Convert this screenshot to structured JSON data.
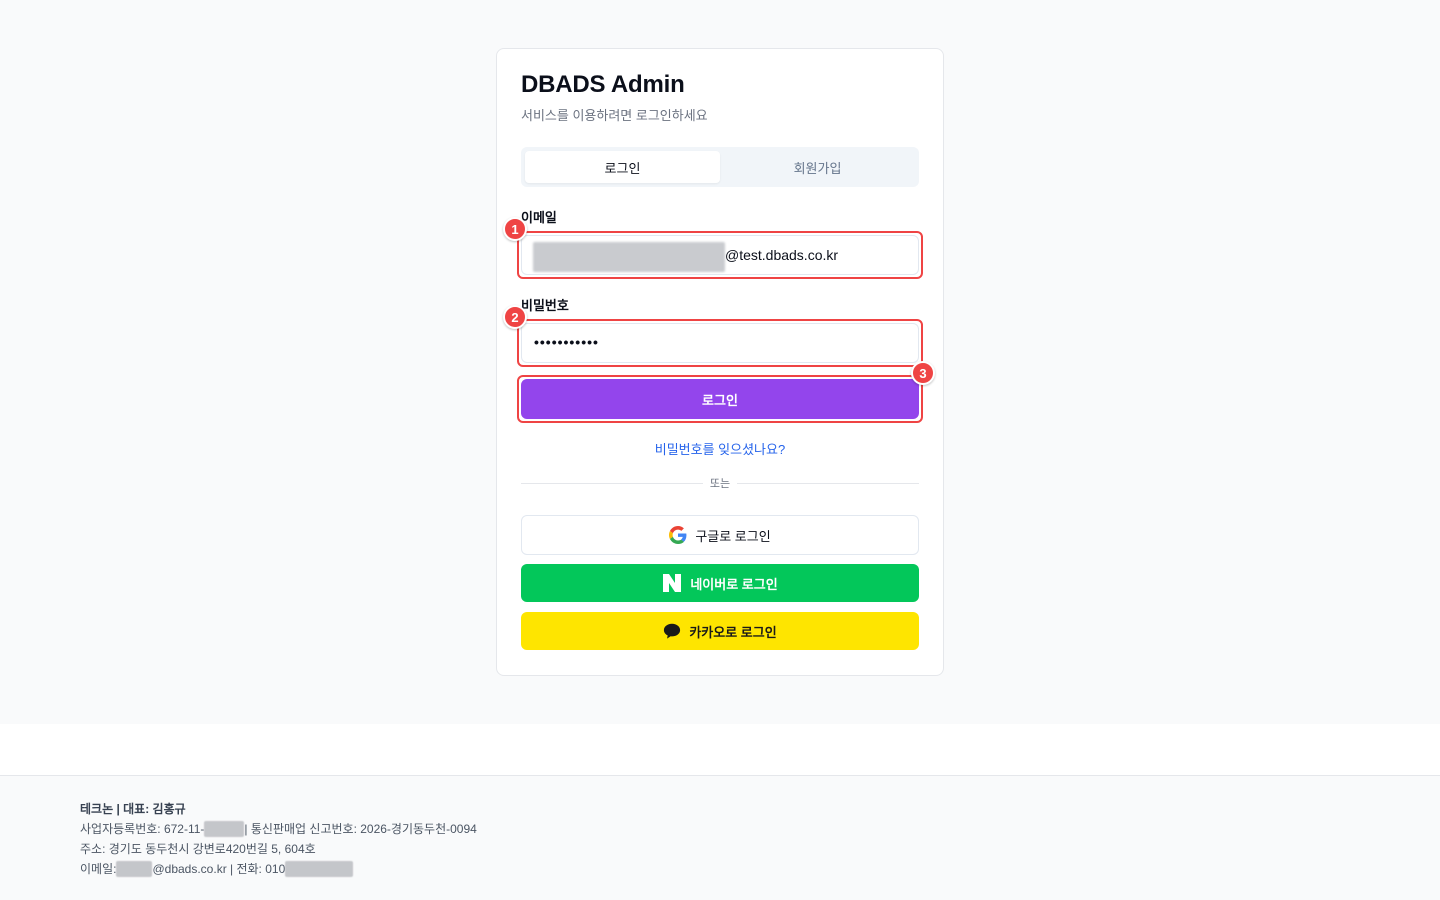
{
  "login_card": {
    "title": "DBADS Admin",
    "subtitle": "서비스를 이용하려면 로그인하세요",
    "tabs": [
      {
        "label": "로그인",
        "active": true
      },
      {
        "label": "회원가입",
        "active": false
      }
    ],
    "email_label": "이메일",
    "email_value": "@test.dbads.co.kr",
    "password_label": "비밀번호",
    "password_value": "•••••••••••",
    "submit_label": "로그인",
    "forgot_link": "비밀번호를 잊으셨나요?",
    "divider_text": "또는",
    "social": {
      "google_label": "구글로 로그인",
      "naver_label": "네이버로 로그인",
      "kakao_label": "카카오로 로그인"
    }
  },
  "annotations": {
    "badge_1": "1",
    "badge_2": "2",
    "badge_3": "3",
    "highlight_color": "#ef4444"
  },
  "footer": {
    "company": "테크논 | 대표: 김홍규",
    "biz_reg_prefix": "사업자등록번호: 672-11-",
    "biz_reg_suffix": " | 통신판매업 신고번호: 2026-경기동두천-0094",
    "address": "주소: 경기도 동두천시 강변로420번길 5, 604호",
    "email_prefix": "이메일: ",
    "email_suffix": "@dbads.co.kr | 전화: 010"
  },
  "colors": {
    "primary": "#9345ec",
    "naver": "#03c75a",
    "kakao": "#fee500",
    "link": "#2563eb"
  },
  "icons": {
    "google": "google-g-icon",
    "naver": "naver-n-icon",
    "kakao": "kakao-speech-bubble-icon"
  }
}
